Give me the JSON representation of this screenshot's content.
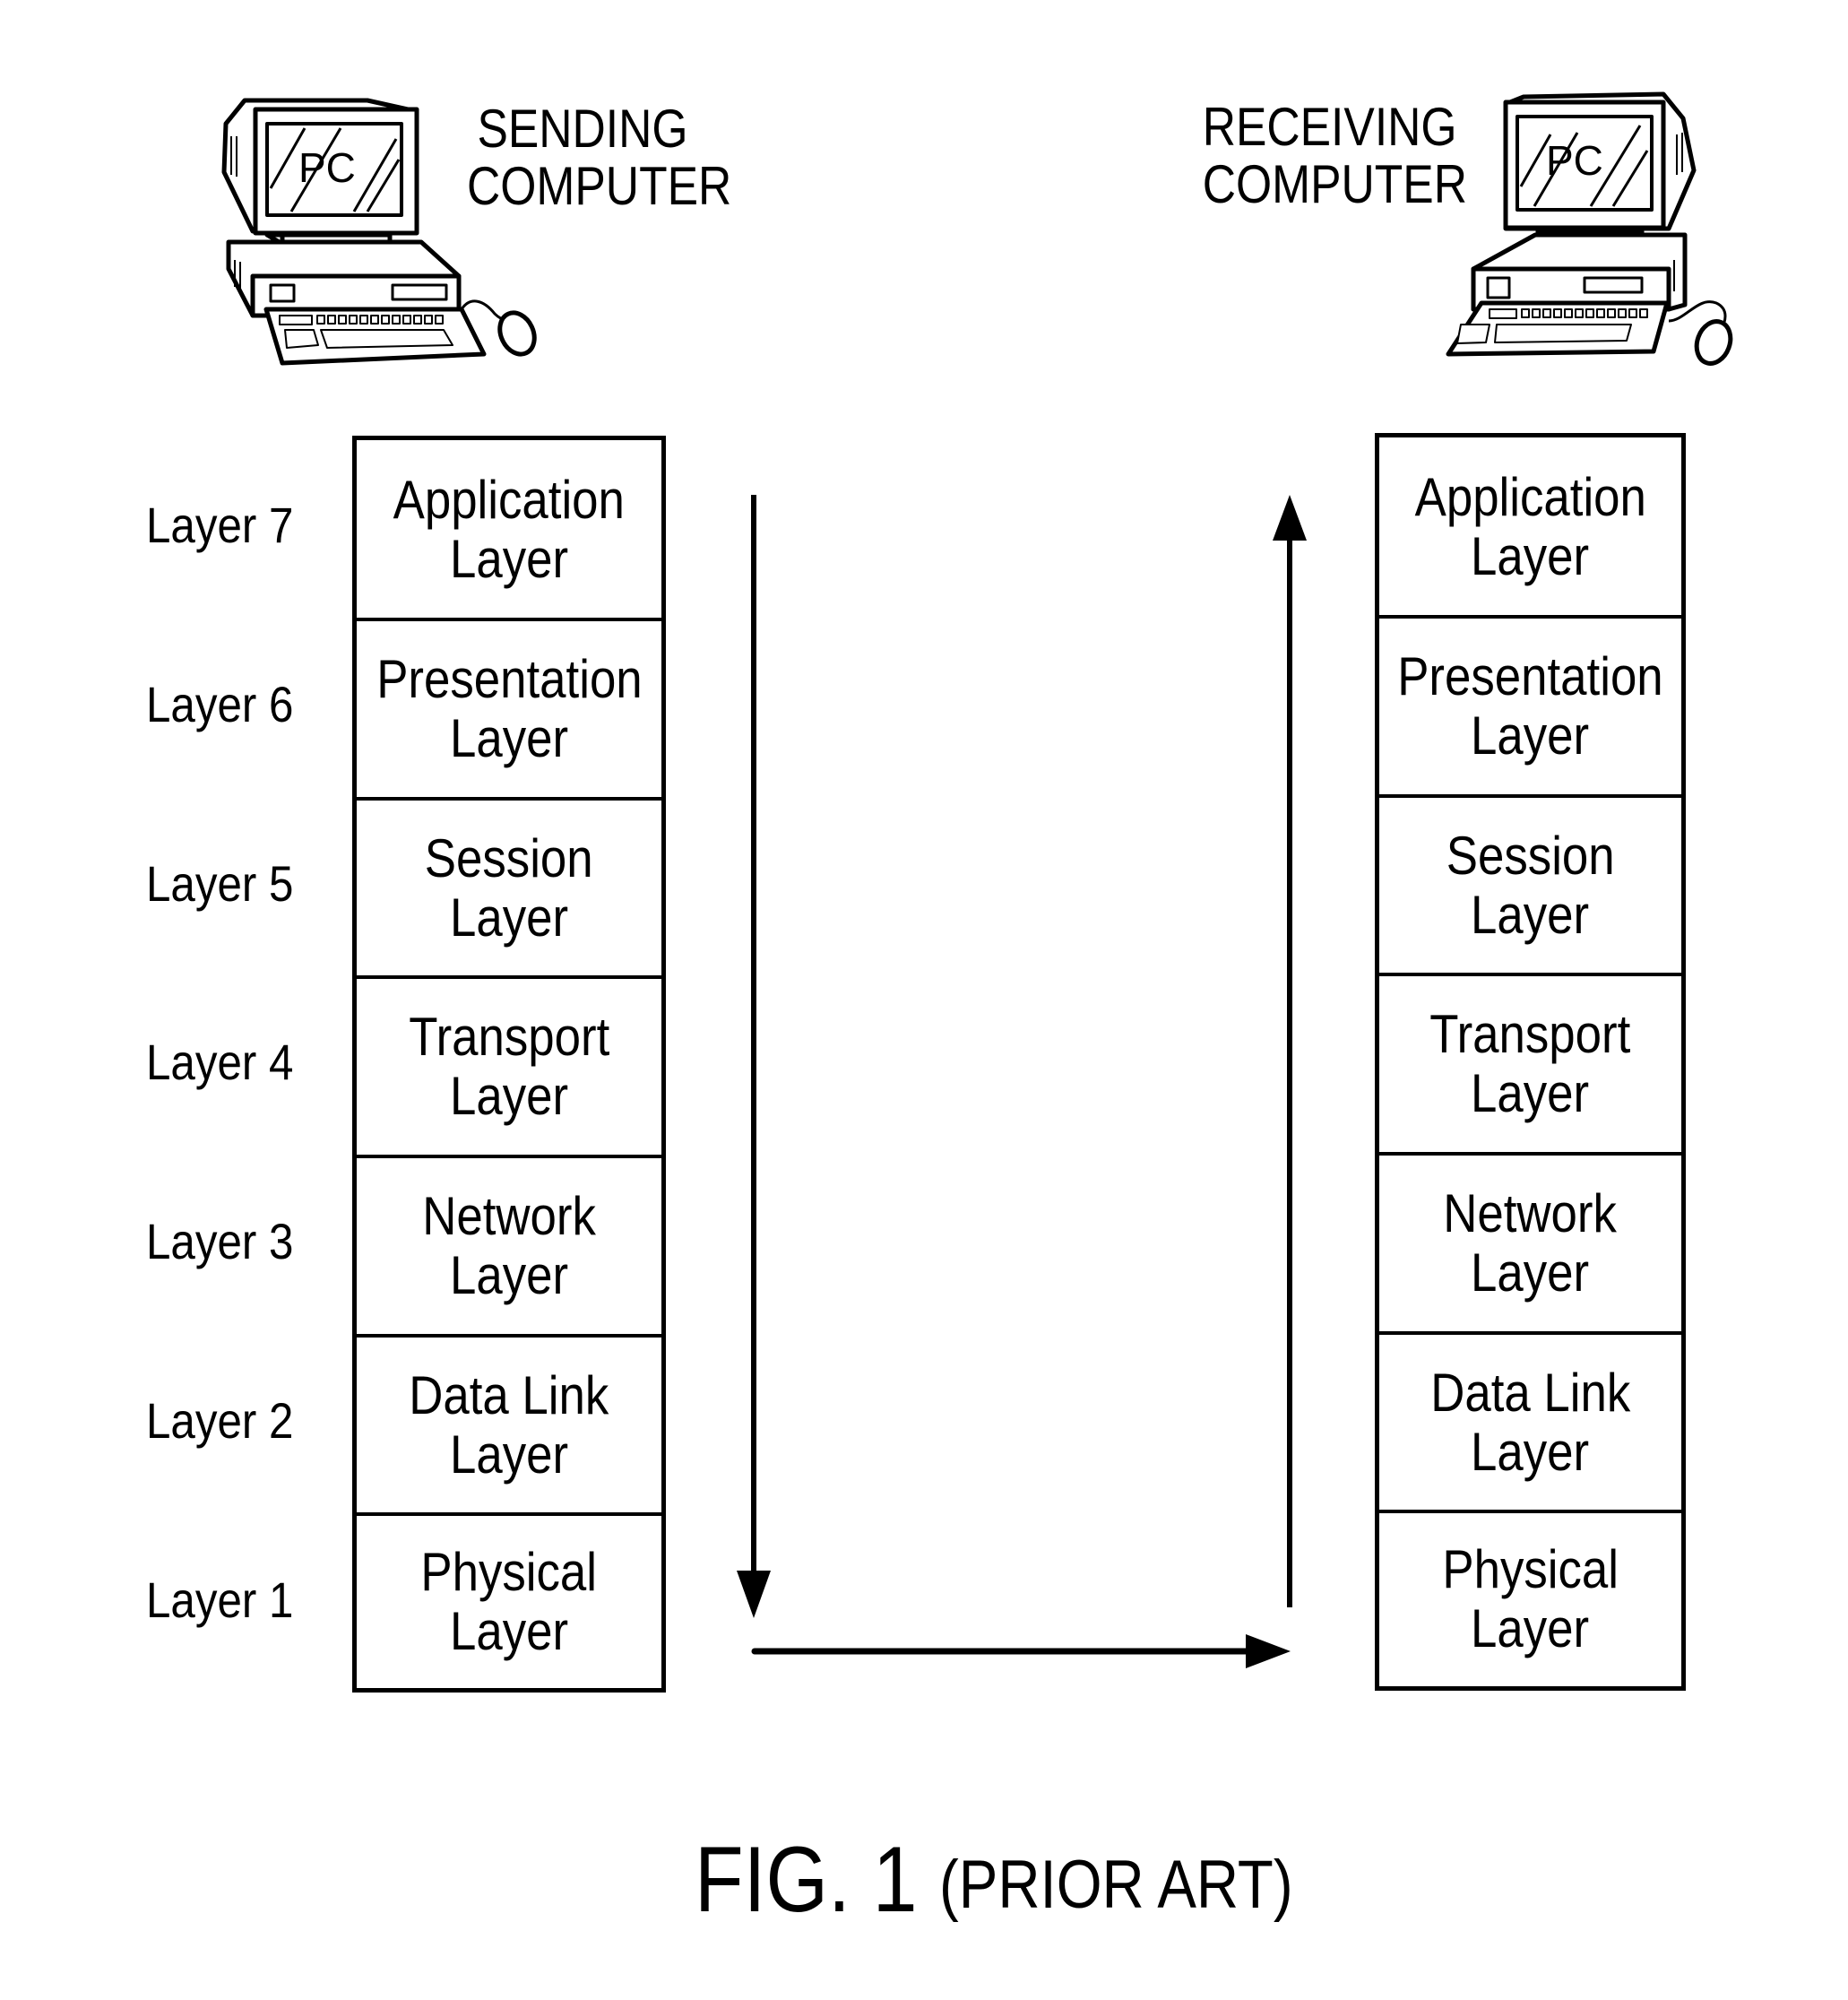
{
  "sending": {
    "title_line1": "SENDING",
    "title_line2": "COMPUTER",
    "screen_label": "PC"
  },
  "receiving": {
    "title_line1": "RECEIVING",
    "title_line2": "COMPUTER",
    "screen_label": "PC"
  },
  "layer_labels": [
    "Layer 7",
    "Layer 6",
    "Layer 5",
    "Layer 4",
    "Layer 3",
    "Layer 2",
    "Layer 1"
  ],
  "sending_stack": [
    {
      "line1": "Application",
      "line2": "Layer"
    },
    {
      "line1": "Presentation",
      "line2": "Layer"
    },
    {
      "line1": "Session",
      "line2": "Layer"
    },
    {
      "line1": "Transport",
      "line2": "Layer"
    },
    {
      "line1": "Network",
      "line2": "Layer"
    },
    {
      "line1": "Data Link",
      "line2": "Layer"
    },
    {
      "line1": "Physical",
      "line2": "Layer"
    }
  ],
  "receiving_stack": [
    {
      "line1": "Application",
      "line2": "Layer"
    },
    {
      "line1": "Presentation",
      "line2": "Layer"
    },
    {
      "line1": "Session",
      "line2": "Layer"
    },
    {
      "line1": "Transport",
      "line2": "Layer"
    },
    {
      "line1": "Network",
      "line2": "Layer"
    },
    {
      "line1": "Data Link",
      "line2": "Layer"
    },
    {
      "line1": "Physical",
      "line2": "Layer"
    }
  ],
  "arrows": {
    "down": "down-arrow",
    "across": "right-arrow",
    "up": "up-arrow"
  },
  "caption": {
    "figure": "FIG. 1",
    "note": "(PRIOR ART)"
  }
}
